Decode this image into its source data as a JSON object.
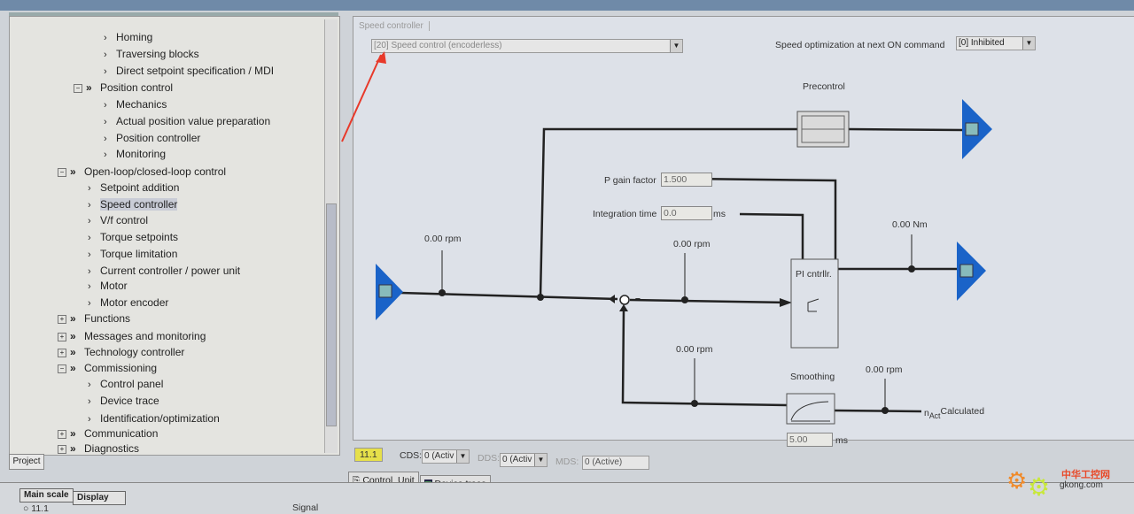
{
  "project_tree": {
    "items": [
      {
        "label": "Homing",
        "level": 2,
        "type": "leaf"
      },
      {
        "label": "Traversing blocks",
        "level": 2,
        "type": "leaf"
      },
      {
        "label": "Direct setpoint specification / MDI",
        "level": 2,
        "type": "leaf"
      },
      {
        "label": "Position control",
        "level": 1,
        "type": "expanded"
      },
      {
        "label": "Mechanics",
        "level": 2,
        "type": "leaf"
      },
      {
        "label": "Actual position value preparation",
        "level": 2,
        "type": "leaf"
      },
      {
        "label": "Position controller",
        "level": 2,
        "type": "leaf"
      },
      {
        "label": "Monitoring",
        "level": 2,
        "type": "leaf"
      },
      {
        "label": "Open-loop/closed-loop control",
        "level": 0,
        "type": "expanded"
      },
      {
        "label": "Setpoint addition",
        "level": 1,
        "type": "leaf"
      },
      {
        "label": "Speed controller",
        "level": 1,
        "type": "leaf",
        "selected": true
      },
      {
        "label": "V/f control",
        "level": 1,
        "type": "leaf"
      },
      {
        "label": "Torque setpoints",
        "level": 1,
        "type": "leaf"
      },
      {
        "label": "Torque limitation",
        "level": 1,
        "type": "leaf"
      },
      {
        "label": "Current controller / power unit",
        "level": 1,
        "type": "leaf"
      },
      {
        "label": "Motor",
        "level": 1,
        "type": "leaf"
      },
      {
        "label": "Motor encoder",
        "level": 1,
        "type": "leaf"
      },
      {
        "label": "Functions",
        "level": 0,
        "type": "collapsed"
      },
      {
        "label": "Messages and monitoring",
        "level": 0,
        "type": "collapsed"
      },
      {
        "label": "Technology controller",
        "level": 0,
        "type": "collapsed"
      },
      {
        "label": "Commissioning",
        "level": 0,
        "type": "expanded"
      },
      {
        "label": "Control panel",
        "level": 1,
        "type": "leaf"
      },
      {
        "label": "Device trace",
        "level": 1,
        "type": "leaf"
      },
      {
        "label": "Identification/optimization",
        "level": 1,
        "type": "leaf"
      },
      {
        "label": "Communication",
        "level": 0,
        "type": "collapsed"
      },
      {
        "label": "Diagnostics",
        "level": 0,
        "type": "collapsed"
      }
    ],
    "tab_label": "Project"
  },
  "editor": {
    "tab_label": "Speed controller",
    "control_mode": "[20] Speed control (encoderless)",
    "speed_opt_label": "Speed optimization at next ON command",
    "speed_opt_value": "[0] Inhibited",
    "precontrol_label": "Precontrol",
    "p_gain_label": "P gain factor",
    "p_gain_value": "1.500",
    "integration_label": "Integration time",
    "integration_value": "0.0",
    "integration_unit": "ms",
    "pi_label": "PI cntrllr.",
    "speed_setpoint": "0.00 rpm",
    "speed_error": "0.00 rpm",
    "torque_out": "0.00 Nm",
    "speed_feedback": "0.00 rpm",
    "smoothing_label": "Smoothing",
    "smoothing_value": "5.00",
    "smoothing_unit": "ms",
    "actual_speed": "0.00 rpm",
    "n_act_symbol": "n",
    "n_act_sub": "Act",
    "n_act_label": "Calculated",
    "minus_sign": "–"
  },
  "status": {
    "drive_id": "11.1",
    "cds_label": "CDS:",
    "cds_value": "0 (Activ",
    "dds_label": "DDS:",
    "dds_value": "0 (Activ",
    "mds_label": "MDS:",
    "mds_value": "0 (Active)"
  },
  "bottom_tabs": [
    "Control_Unit",
    "Device trace"
  ],
  "bottom_panel": {
    "col_main_scale": "Main scale",
    "col_display": "Display",
    "col_signal": "Signal",
    "row1": "11.1"
  },
  "watermark": {
    "text_cn": "中华工控网",
    "text": "gkong.com"
  },
  "colors": {
    "arrow_annotation": "#e8392a",
    "connector_blue": "#1a63c8",
    "selected_highlight": "#c9ccd6",
    "drive_id_bg": "#e6e04a"
  }
}
